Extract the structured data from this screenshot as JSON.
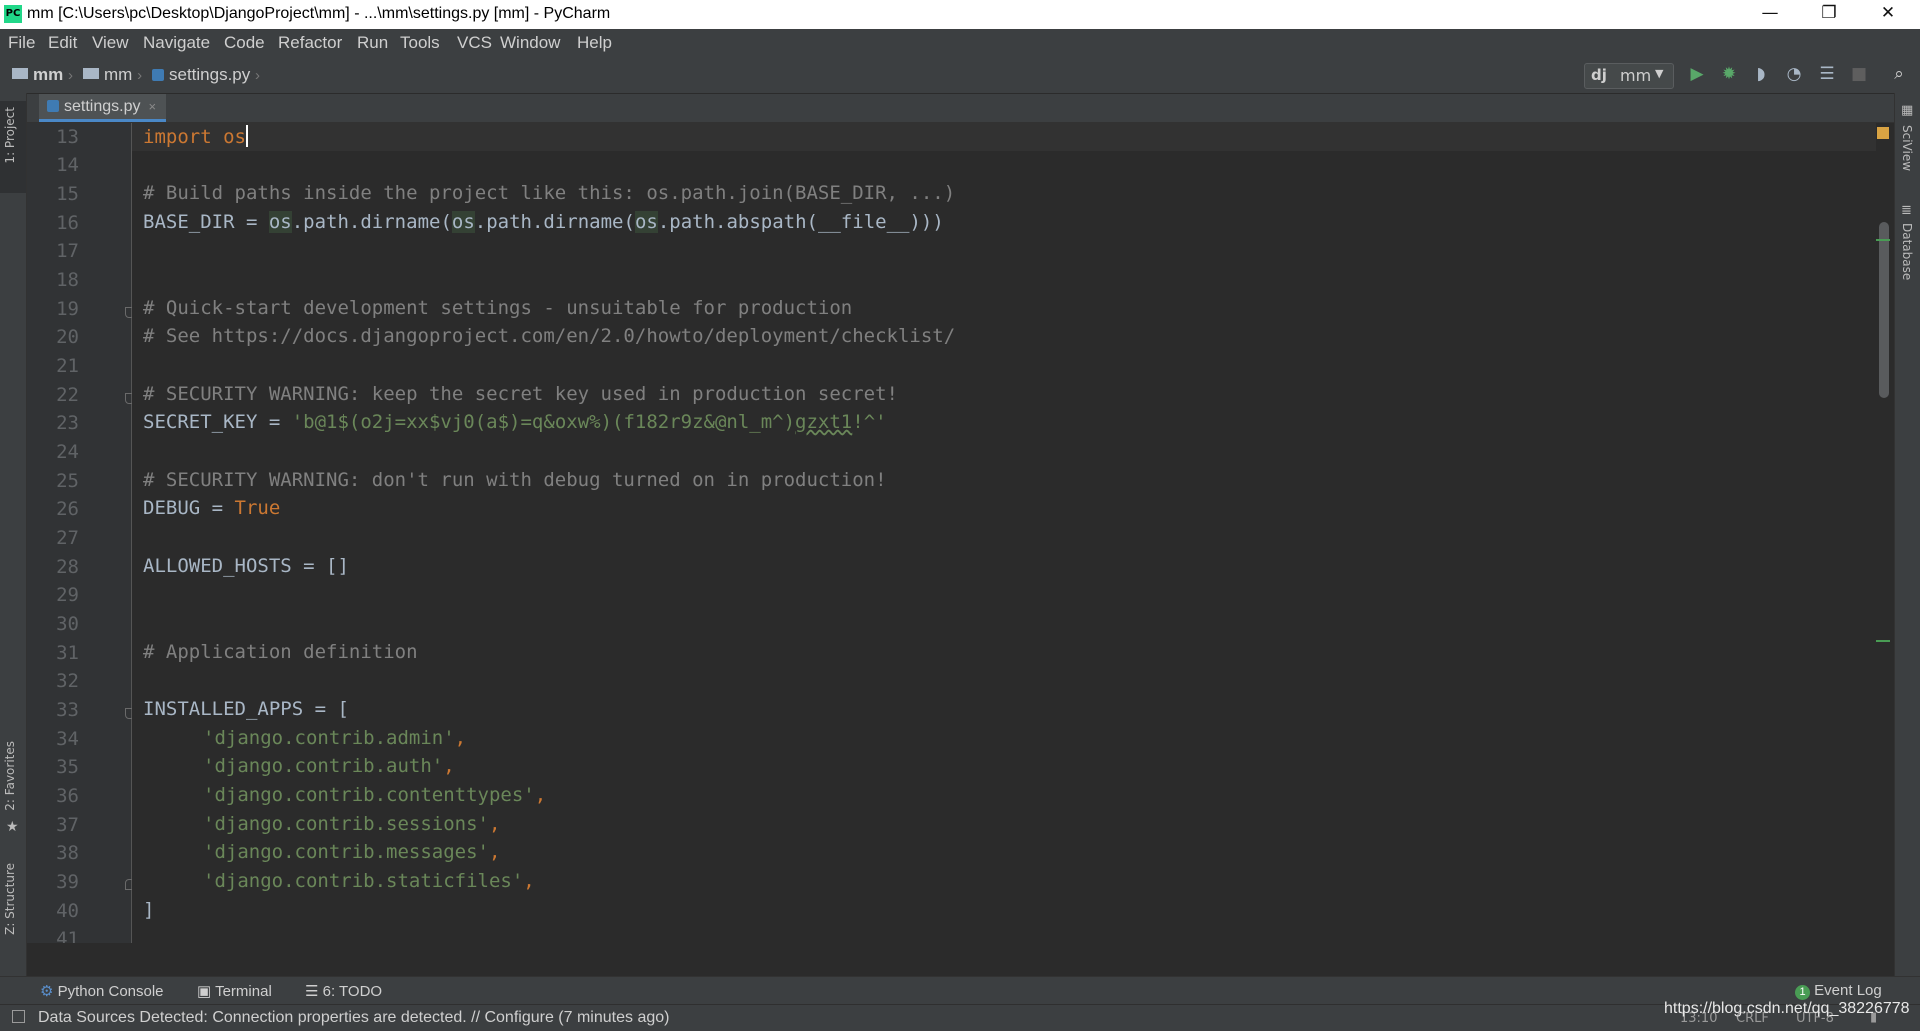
{
  "window": {
    "title": "mm [C:\\Users\\pc\\Desktop\\DjangoProject\\mm] - ...\\mm\\settings.py [mm] - PyCharm",
    "app_icon": "PC",
    "minimize": "—",
    "restore": "❐",
    "close": "✕"
  },
  "menu": [
    "File",
    "Edit",
    "View",
    "Navigate",
    "Code",
    "Refactor",
    "Run",
    "Tools",
    "VCS",
    "Window",
    "Help"
  ],
  "breadcrumb": [
    "mm",
    "mm",
    "settings.py"
  ],
  "run_config": {
    "badge": "dj",
    "name": "mm"
  },
  "toolbar_icons": [
    "run-icon",
    "debug-icon",
    "coverage-icon",
    "profile-icon",
    "concurrency-icon",
    "stop-icon",
    "search-icon"
  ],
  "left_tool_windows": [
    "1: Project",
    "2: Favorites",
    "Z: Structure"
  ],
  "right_tool_windows": [
    "SciView",
    "Database"
  ],
  "editor_tab": {
    "label": "settings.py",
    "close": "×"
  },
  "line_numbers": [
    "13",
    "14",
    "15",
    "16",
    "17",
    "18",
    "19",
    "20",
    "21",
    "22",
    "23",
    "24",
    "25",
    "26",
    "27",
    "28",
    "29",
    "30",
    "31",
    "32",
    "33",
    "34",
    "35",
    "36",
    "37",
    "38",
    "39",
    "40",
    "41"
  ],
  "code": {
    "l13_kw": "import",
    "l13_mod": "os",
    "l15": "# Build paths inside the project like this: os.path.join(BASE_DIR, ...)",
    "l16_a": "BASE_DIR = ",
    "l16_os1": "os",
    "l16_b": ".path.dirname(",
    "l16_os2": "os",
    "l16_c": ".path.dirname(",
    "l16_os3": "os",
    "l16_d": ".path.abspath(__file__)))",
    "l19": "# Quick-start development settings - unsuitable for production",
    "l20": "# See https://docs.djangoproject.com/en/2.0/howto/deployment/checklist/",
    "l22": "# SECURITY WARNING: keep the secret key used in production secret!",
    "l23_a": "SECRET_KEY = ",
    "l23_s1": "'b@1$(o2j=xx$vj0(a$)=q&oxw%)(f182r9z&@nl_m^)",
    "l23_s2": "gzxt1",
    "l23_s3": "!^'",
    "l25": "# SECURITY WARNING: don't run with debug turned on in production!",
    "l26_a": "DEBUG = ",
    "l26_kw": "True",
    "l28": "ALLOWED_HOSTS = []",
    "l31": "# Application definition",
    "l33": "INSTALLED_APPS = [",
    "l34": "'django.contrib.admin'",
    "l35": "'django.contrib.auth'",
    "l36": "'django.contrib.contenttypes'",
    "l37": "'django.contrib.sessions'",
    "l38": "'django.contrib.messages'",
    "l39": "'django.contrib.staticfiles'",
    "comma": ",",
    "l40": "]"
  },
  "bottom_tabs": [
    "Python Console",
    "Terminal",
    "6: TODO"
  ],
  "event_log": {
    "count": "1",
    "label": "Event Log"
  },
  "status": {
    "message": "Data Sources Detected: Connection properties are detected. // Configure (7 minutes ago)",
    "position": "13:10",
    "line_sep": "CRLF",
    "encoding": "UTF-8"
  },
  "watermark": "https://blog.csdn.net/qq_38226778",
  "colors": {
    "background": "#2b2b2b",
    "keyword": "#cc7832",
    "comment": "#808080",
    "string": "#6a8759",
    "text": "#a9b7c6",
    "run_green": "#59a869"
  }
}
